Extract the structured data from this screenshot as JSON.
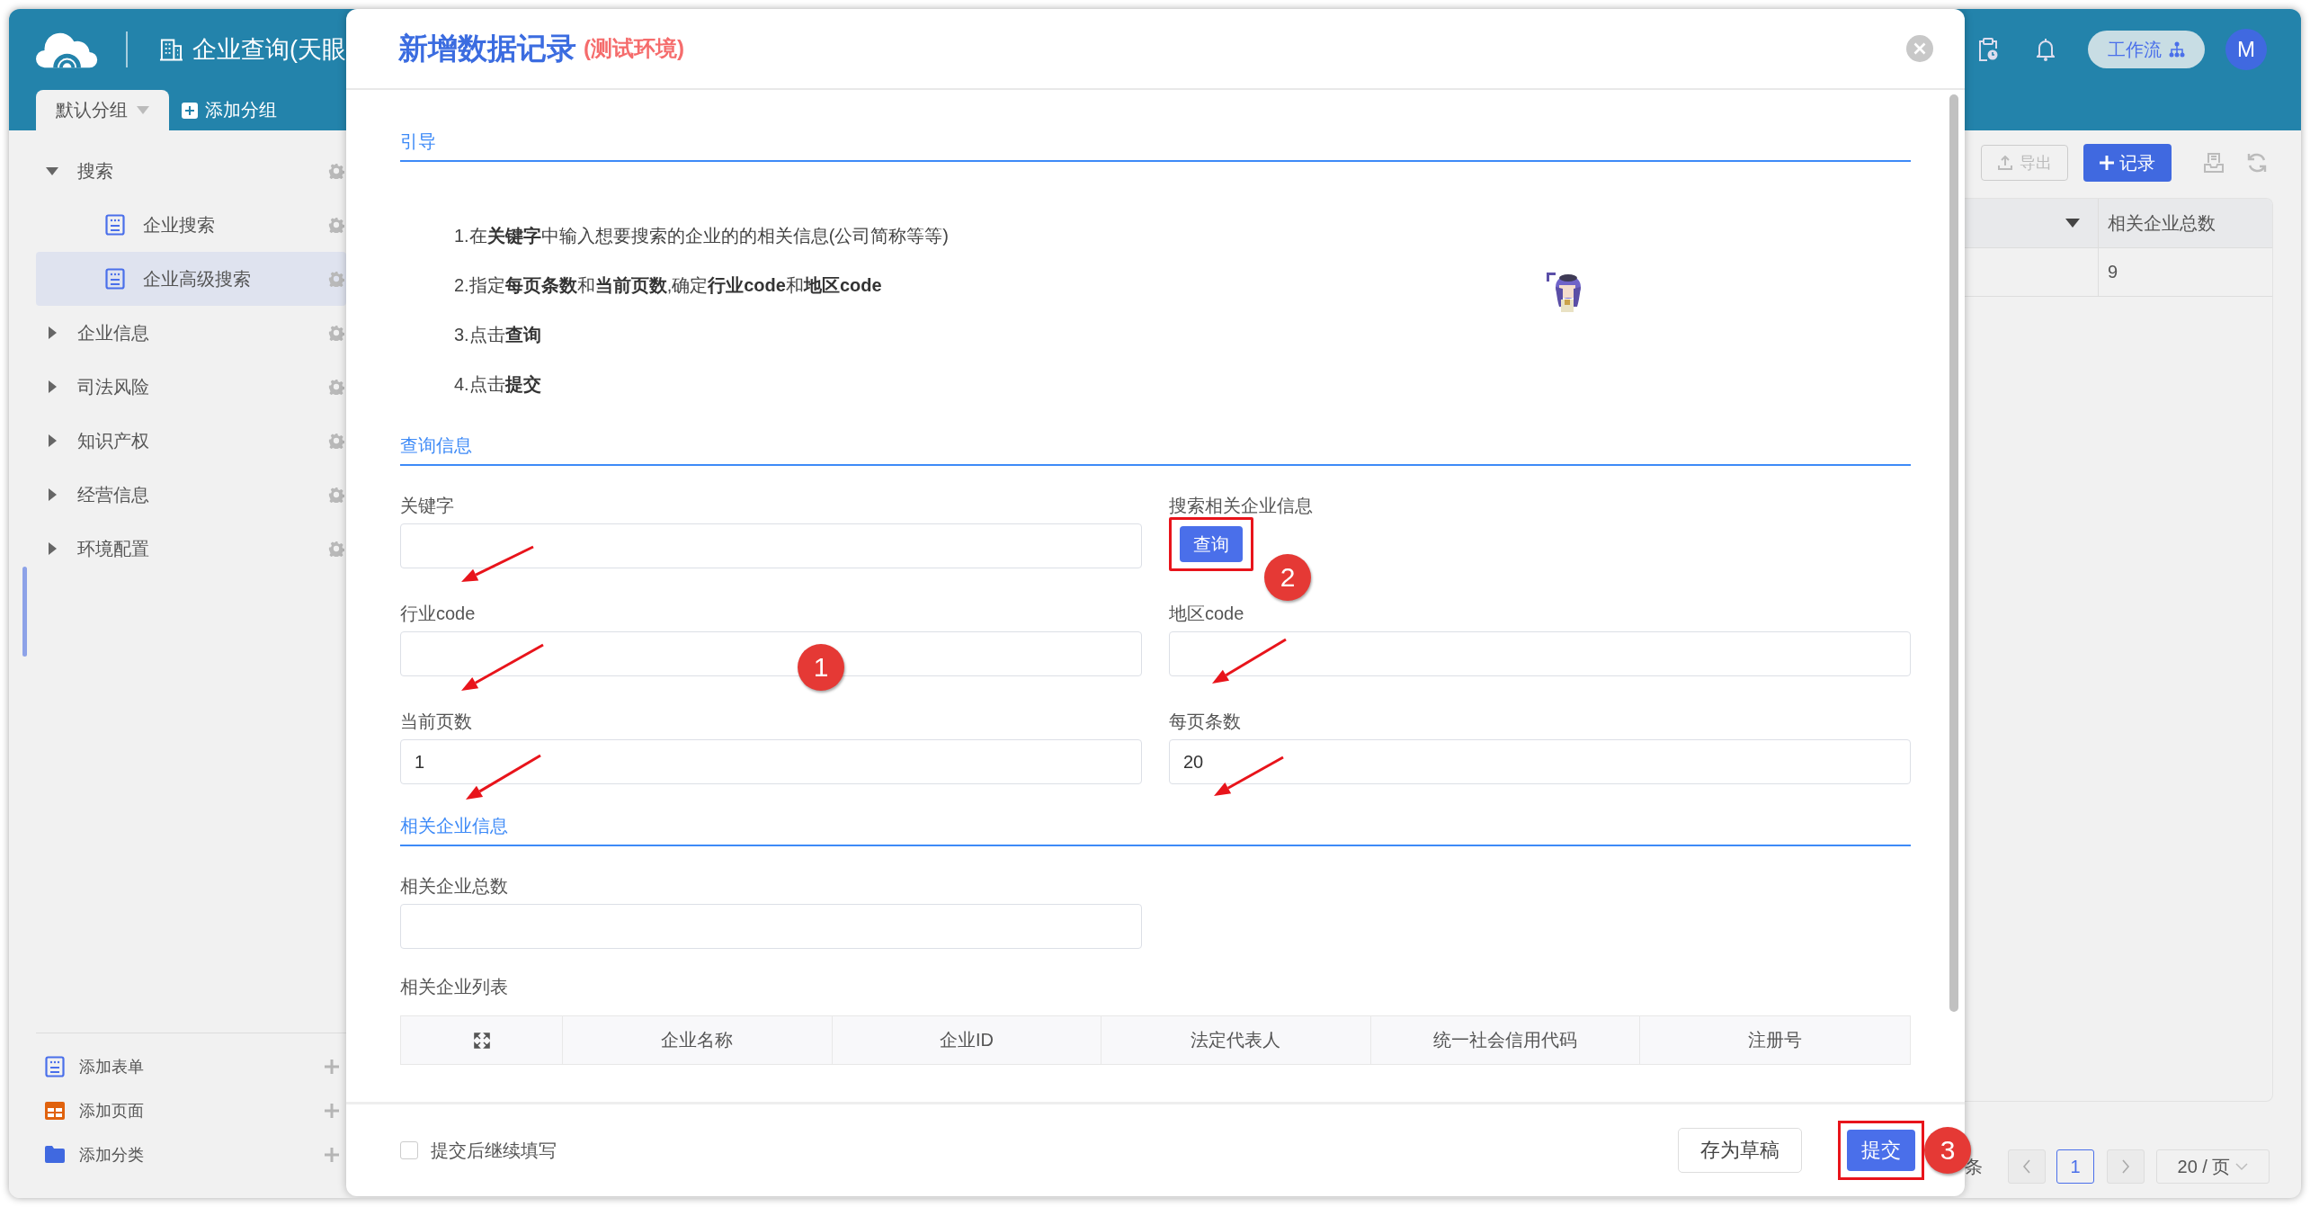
{
  "app": {
    "title": "企业查询(天眼",
    "group_tabs": [
      {
        "label": "默认分组",
        "selected": true
      }
    ],
    "add_group": "添加分组"
  },
  "header": {
    "workflow": "工作流",
    "avatar": "M"
  },
  "sidebar": {
    "tree": [
      {
        "label": "搜索",
        "expanded": true,
        "selected": false,
        "children": [
          {
            "label": "企业搜索",
            "selected": false
          },
          {
            "label": "企业高级搜索",
            "selected": true
          }
        ]
      },
      {
        "label": "企业信息",
        "expanded": false,
        "selected": false
      },
      {
        "label": "司法风险",
        "expanded": false,
        "selected": false
      },
      {
        "label": "知识产权",
        "expanded": false,
        "selected": false
      },
      {
        "label": "经营信息",
        "expanded": false,
        "selected": false
      },
      {
        "label": "环境配置",
        "expanded": false,
        "selected": false
      }
    ],
    "footer_items": [
      {
        "label": "添加表单",
        "kind": "form"
      },
      {
        "label": "添加页面",
        "kind": "page"
      },
      {
        "label": "添加分类",
        "kind": "folder"
      }
    ]
  },
  "toolbar": {
    "export": "导出",
    "add_record": "记录"
  },
  "table": {
    "columns": [
      "相关企业总数"
    ],
    "rows": [
      [
        "9"
      ]
    ]
  },
  "pagination": {
    "total_suffix": "条",
    "pages": [
      {
        "label": "1",
        "selected": true
      }
    ],
    "page_size": "20 / 页"
  },
  "modal": {
    "title": "新增数据记录",
    "env_tag": "(测试环境)",
    "guide": {
      "heading": "引导",
      "lines": [
        "1.在**关键字**中输入想要搜索的企业的的相关信息(公司简称等等)",
        "2.指定**每页条数**和**当前页数**,确定**行业code**和**地区code**",
        "3.点击**查询**",
        "4.点击**提交**"
      ]
    },
    "query": {
      "heading": "查询信息",
      "fields": [
        {
          "label": "关键字",
          "kind": "input"
        },
        {
          "label": "搜索相关企业信息",
          "kind": "button",
          "button": "查询"
        },
        {
          "label": "行业code",
          "kind": "input"
        },
        {
          "label": "地区code",
          "kind": "input"
        },
        {
          "label": "当前页数",
          "kind": "input",
          "value": "1"
        },
        {
          "label": "每页条数",
          "kind": "input",
          "value": "20"
        }
      ]
    },
    "related": {
      "heading": "相关企业信息",
      "total_label": "相关企业总数",
      "list_label": "相关企业列表",
      "columns": [
        "企业名称",
        "企业ID",
        "法定代表人",
        "统一社会信用代码",
        "注册号"
      ]
    },
    "footer": {
      "continue_label": "提交后继续填写",
      "continue_checked": false,
      "draft": "存为草稿",
      "submit": "提交"
    }
  },
  "annotations": {
    "callouts": [
      "1",
      "2",
      "3"
    ]
  }
}
